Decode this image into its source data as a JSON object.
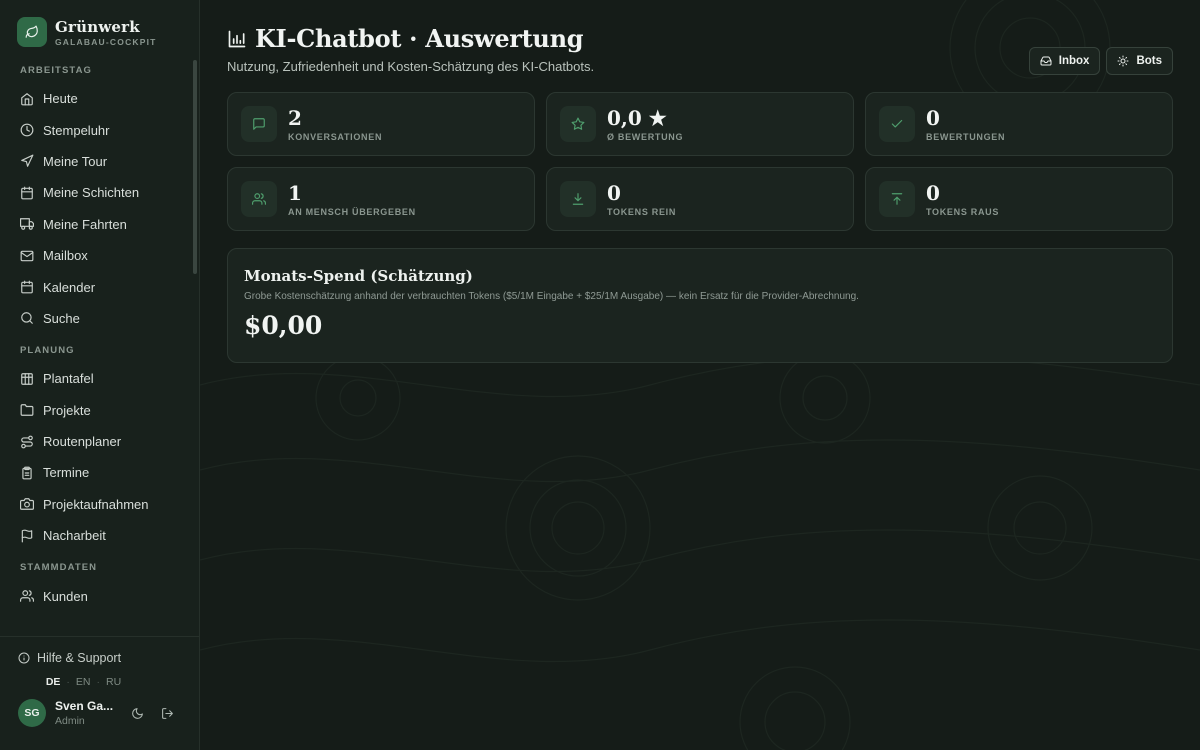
{
  "brand": {
    "name": "Grünwerk",
    "subtitle": "GALABAU-COCKPIT"
  },
  "sidebar": {
    "sections": [
      {
        "title": "ARBEITSTAG",
        "items": [
          {
            "label": "Heute",
            "icon": "home-icon"
          },
          {
            "label": "Stempeluhr",
            "icon": "clock-icon"
          },
          {
            "label": "Meine Tour",
            "icon": "navigation-icon"
          },
          {
            "label": "Meine Schichten",
            "icon": "calendar-icon"
          },
          {
            "label": "Meine Fahrten",
            "icon": "truck-icon"
          },
          {
            "label": "Mailbox",
            "icon": "mail-icon"
          },
          {
            "label": "Kalender",
            "icon": "calendar-icon"
          },
          {
            "label": "Suche",
            "icon": "search-icon"
          }
        ]
      },
      {
        "title": "PLANUNG",
        "items": [
          {
            "label": "Plantafel",
            "icon": "grid-icon"
          },
          {
            "label": "Projekte",
            "icon": "folder-icon"
          },
          {
            "label": "Routenplaner",
            "icon": "route-icon"
          },
          {
            "label": "Termine",
            "icon": "clipboard-icon"
          },
          {
            "label": "Projektaufnahmen",
            "icon": "camera-icon"
          },
          {
            "label": "Nacharbeit",
            "icon": "flag-icon"
          }
        ]
      },
      {
        "title": "STAMMDATEN",
        "items": [
          {
            "label": "Kunden",
            "icon": "users-icon"
          }
        ]
      }
    ],
    "help_label": "Hilfe & Support",
    "languages": [
      "DE",
      "EN",
      "RU"
    ],
    "active_language": "DE",
    "user": {
      "initials": "SG",
      "name": "Sven Ga...",
      "role": "Admin"
    }
  },
  "header": {
    "title": "KI-Chatbot · Auswertung",
    "subtitle": "Nutzung, Zufriedenheit und Kosten-Schätzung des KI-Chatbots.",
    "inbox_label": "Inbox",
    "bots_label": "Bots"
  },
  "stats": [
    {
      "value": "2",
      "label": "KONVERSATIONEN",
      "icon": "chat-icon"
    },
    {
      "value": "0,0 ★",
      "label": "Ø BEWERTUNG",
      "icon": "star-icon"
    },
    {
      "value": "0",
      "label": "BEWERTUNGEN",
      "icon": "check-icon"
    },
    {
      "value": "1",
      "label": "AN MENSCH ÜBERGEBEN",
      "icon": "users-icon"
    },
    {
      "value": "0",
      "label": "TOKENS REIN",
      "icon": "download-icon"
    },
    {
      "value": "0",
      "label": "TOKENS RAUS",
      "icon": "upload-icon"
    }
  ],
  "spend": {
    "title": "Monats-Spend (Schätzung)",
    "description": "Grobe Kostenschätzung anhand der verbrauchten Tokens ($5/1M Eingabe + $25/1M Ausgabe) — kein Ersatz für die Provider-Abrechnung.",
    "value": "$0,00"
  },
  "colors": {
    "accent": "#2f6a47",
    "icon_green": "#4f9e6d",
    "background": "#151c18",
    "card": "#1b241f"
  }
}
